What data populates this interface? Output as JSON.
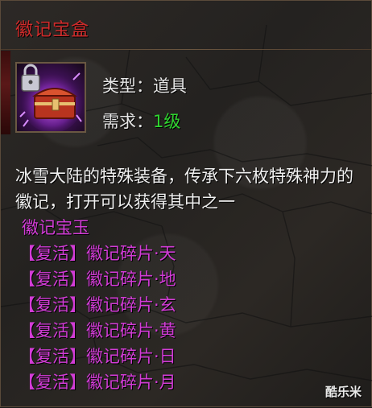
{
  "item": {
    "title": "徽记宝盒",
    "type_label": "类型：",
    "type_value": "道具",
    "req_label": "需求：",
    "req_value": "1级",
    "description": "冰雪大陆的特殊装备，传承下六枚特殊神力的徽记，打开可以获得其中之一",
    "contents": [
      "徽记宝玉",
      "【复活】徽记碎片·天",
      "【复活】徽记碎片·地",
      "【复活】徽记碎片·玄",
      "【复活】徽记碎片·黄",
      "【复活】徽记碎片·日",
      "【复活】徽记碎片·月"
    ]
  },
  "colors": {
    "title": "#d12b2b",
    "level": "#2fd42f",
    "contents": "#d23cd6",
    "text": "#e6e6e6"
  },
  "icon": "locked-treasure-chest-icon",
  "watermark": "酷乐米"
}
